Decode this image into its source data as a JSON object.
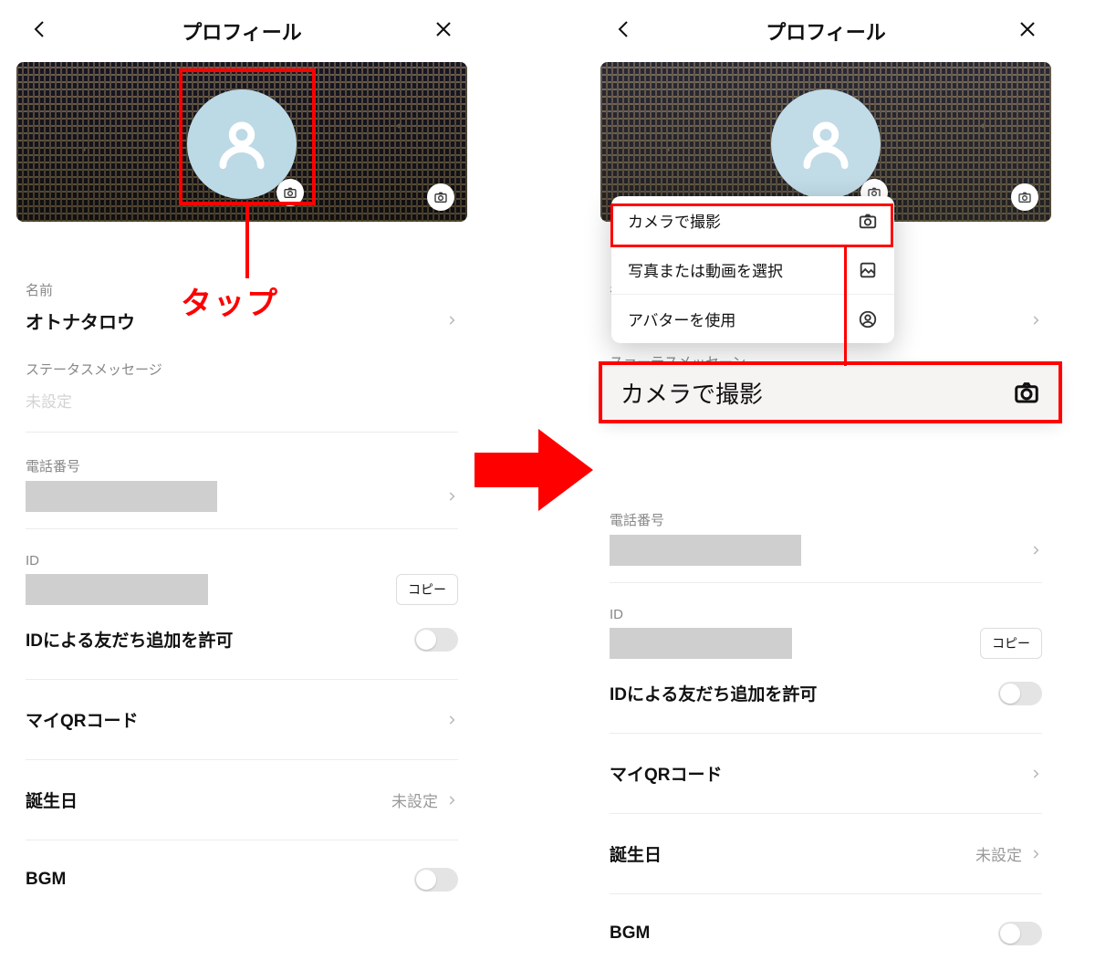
{
  "header": {
    "title": "プロフィール"
  },
  "annotation": {
    "tap": "タップ"
  },
  "left": {
    "name_label": "名前",
    "name_value": "オトナタロウ",
    "status_label": "ステータスメッセージ",
    "status_value": "未設定",
    "phone_label": "電話番号",
    "id_label": "ID",
    "copy": "コピー",
    "allow_add": "IDによる友だち追加を許可",
    "qr": "マイQRコード",
    "birthday": "誕生日",
    "birthday_value": "未設定",
    "bgm": "BGM"
  },
  "right": {
    "status_partial": "スァーテスメッセーン",
    "dropdown": {
      "camera": "カメラで撮影",
      "select": "写真または動画を選択",
      "avatar": "アバターを使用"
    },
    "enlarged": "カメラで撮影",
    "phone_label": "電話番号",
    "id_label": "ID",
    "copy": "コピー",
    "allow_add": "IDによる友だち追加を許可",
    "qr": "マイQRコード",
    "birthday": "誕生日",
    "birthday_value": "未設定",
    "bgm": "BGM"
  }
}
